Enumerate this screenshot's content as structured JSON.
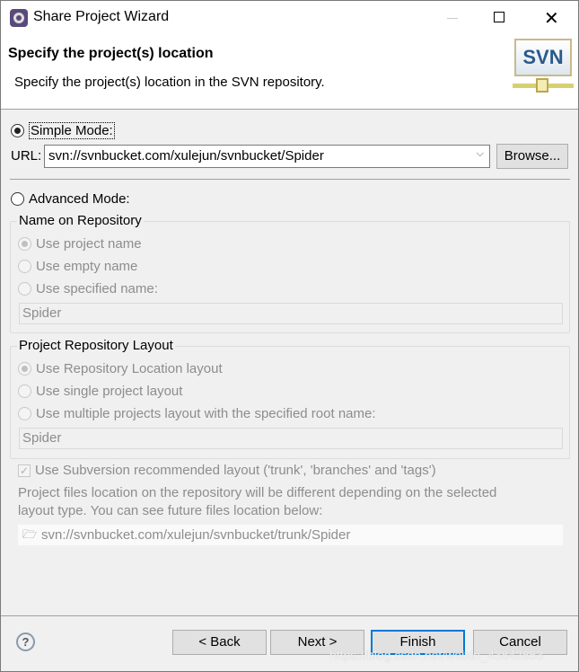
{
  "window": {
    "title": "Share Project Wizard"
  },
  "header": {
    "title": "Specify the project(s) location",
    "description": "Specify the project(s) location in the SVN repository.",
    "logo_text": "SVN"
  },
  "simple_mode": {
    "label": "Simple Mode:",
    "selected": true,
    "url_label": "URL:",
    "url_value": "svn://svnbucket.com/xulejun/svnbucket/Spider",
    "browse_label": "Browse..."
  },
  "advanced_mode": {
    "label": "Advanced Mode:",
    "selected": false
  },
  "name_group": {
    "title": "Name on Repository",
    "options": [
      "Use project name",
      "Use empty name",
      "Use specified name:"
    ],
    "selected_index": 0,
    "field_value": "Spider"
  },
  "layout_group": {
    "title": "Project Repository Layout",
    "options": [
      "Use Repository Location layout",
      "Use single project layout",
      "Use multiple projects layout with the specified root name:"
    ],
    "selected_index": 0,
    "field_value": "Spider"
  },
  "recommended": {
    "label": "Use Subversion recommended layout ('trunk', 'branches' and 'tags')",
    "checked": true
  },
  "info": {
    "line1": "Project files location on the repository will be different depending on the selected",
    "line2": "layout type. You can see future files location below:",
    "path": "svn://svnbucket.com/xulejun/svnbucket/trunk/Spider"
  },
  "footer": {
    "back": "< Back",
    "next": "Next >",
    "finish": "Finish",
    "cancel": "Cancel"
  },
  "watermark": "https://blog.csdn.net/weixin_43842853",
  "colors": {
    "accent": "#0078d7",
    "disabled_text": "#8d8d8d",
    "background": "#f0f0f0"
  }
}
